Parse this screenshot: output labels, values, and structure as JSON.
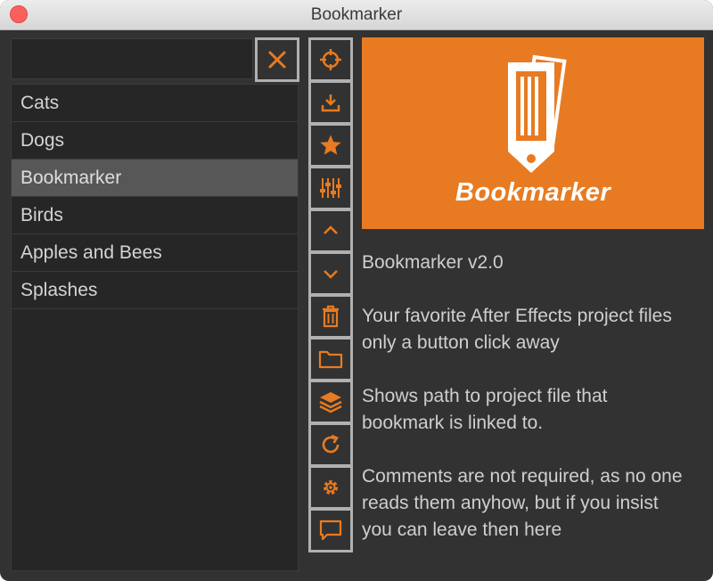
{
  "window": {
    "title": "Bookmarker"
  },
  "search": {
    "value": "",
    "placeholder": ""
  },
  "list": {
    "items": [
      {
        "label": "Cats"
      },
      {
        "label": "Dogs"
      },
      {
        "label": "Bookmarker",
        "selected": true
      },
      {
        "label": "Birds"
      },
      {
        "label": "Apples and Bees"
      },
      {
        "label": "Splashes"
      }
    ]
  },
  "toolbar": {
    "icons": [
      "crosshair-icon",
      "download-icon",
      "star-icon",
      "sliders-icon",
      "chevron-up-icon",
      "chevron-down-icon",
      "trash-icon",
      "folder-icon",
      "layers-icon",
      "refresh-icon",
      "gear-icon",
      "comment-icon"
    ]
  },
  "banner": {
    "title": "Bookmarker"
  },
  "info": {
    "version": "Bookmarker v2.0",
    "description_line1": "Your favorite After Effects project files",
    "description_line2": "only a button click away",
    "path_line1": "Shows path to project file that",
    "path_line2": "bookmark is linked to.",
    "comment_line1": "Comments are not required, as no one",
    "comment_line2": "reads them anyhow, but if you insist",
    "comment_line3": "you can leave then here"
  },
  "colors": {
    "accent": "#e87b21",
    "background": "#323232",
    "list_bg": "#262626",
    "selected": "#575757",
    "text": "#cfcfcf"
  }
}
